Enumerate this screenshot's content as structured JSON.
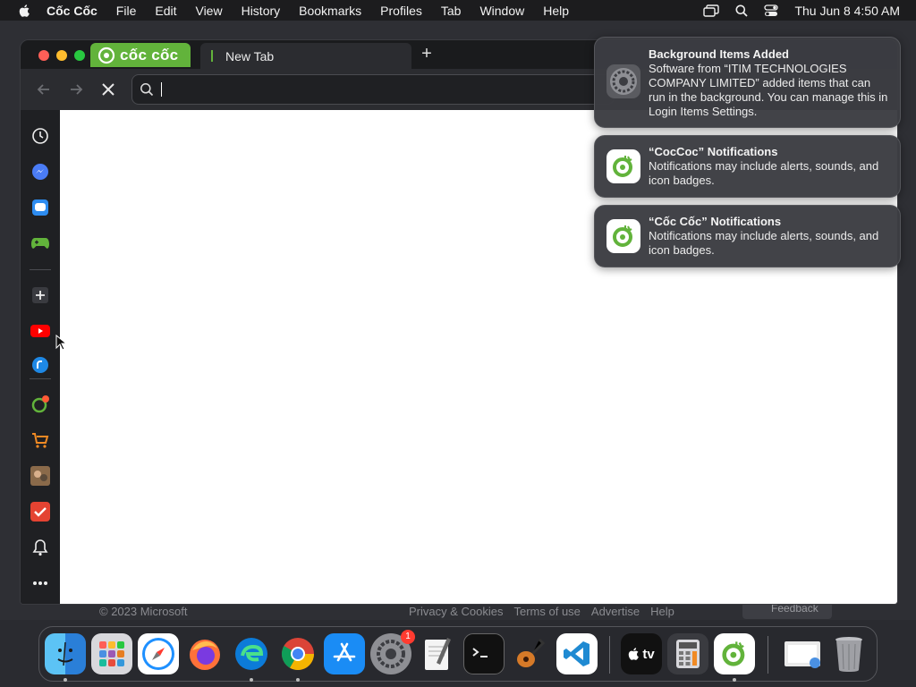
{
  "menubar": {
    "app_name": "Cốc Cốc",
    "items": [
      "File",
      "Edit",
      "View",
      "History",
      "Bookmarks",
      "Profiles",
      "Tab",
      "Window",
      "Help"
    ],
    "clock": "Thu Jun 8  4:50 AM"
  },
  "background": {
    "copyright": "© 2023 Microsoft",
    "links": [
      "Privacy & Cookies",
      "Terms of use",
      "Advertise",
      "Help"
    ],
    "feedback": "Feedback"
  },
  "browser": {
    "brand_label": "cốc cốc",
    "tab_title": "New Tab",
    "address_value": ""
  },
  "notifications": [
    {
      "title": "Background Items Added",
      "body": "Software from “ITIM TECHNOLOGIES COMPANY LIMITED” added items that can run in the background. You can manage this in Login Items Settings.",
      "icon": "gear-icon"
    },
    {
      "title": "“CocCoc” Notifications",
      "body": "Notifications may include alerts, sounds, and icon badges.",
      "icon": "coccoc-icon"
    },
    {
      "title": "“Cốc Cốc” Notifications",
      "body": "Notifications may include alerts, sounds, and icon badges.",
      "icon": "coccoc-icon"
    }
  ],
  "dock": {
    "settings_badge": "1",
    "tv_label": "tv"
  },
  "colors": {
    "coccoc_green": "#62b33b",
    "content_bg": "#ffffff",
    "window_bg": "#1f2023"
  }
}
